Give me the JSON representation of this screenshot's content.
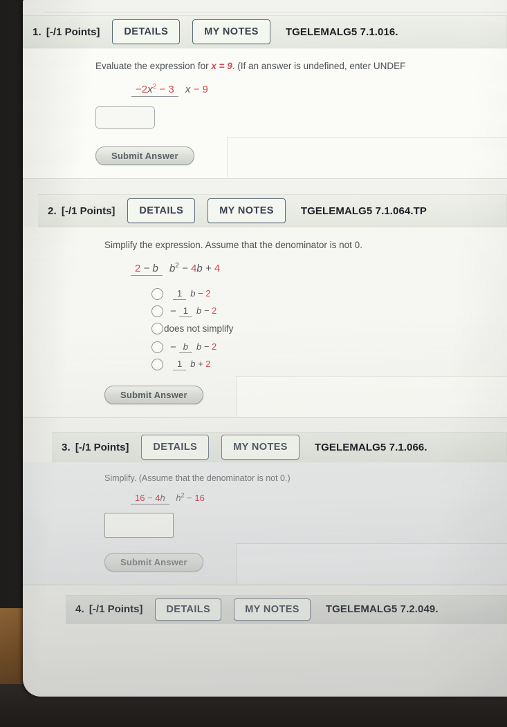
{
  "meta": {
    "app": "WebAssign homework page (photographed screen)",
    "accent_red": "#d94a52",
    "header_bg": "#e8ebe3"
  },
  "problems": [
    {
      "number": "1.",
      "points": "[-/1 Points]",
      "details_label": "DETAILS",
      "notes_label": "MY NOTES",
      "code": "TGELEMALG5 7.1.016.",
      "prompt_pre": "Evaluate the expression for",
      "prompt_var": "x = 9",
      "prompt_post": ". (If an answer is undefined, enter UNDEF",
      "expression": {
        "numerator": "−2x² − 3",
        "denominator": "x − 9",
        "num_main": "−2",
        "num_var": "x",
        "num_exp": "2",
        "num_tail": "− 3",
        "den_var": "x",
        "den_tail": "− 9"
      },
      "answer_value": "",
      "submit_label": "Submit Answer"
    },
    {
      "number": "2.",
      "points": "[-/1 Points]",
      "details_label": "DETAILS",
      "notes_label": "MY NOTES",
      "code": "TGELEMALG5 7.1.064.TP",
      "prompt": "Simplify the expression. Assume that the denominator is not 0.",
      "expression": {
        "num_lead": "2",
        "num_tail": " − b",
        "den_var": "b",
        "den_exp": "2",
        "den_tail1": " − ",
        "den_mid": "4",
        "den_tail2": "b + ",
        "den_end": "4"
      },
      "options": [
        {
          "sign": "",
          "num": "1",
          "den_var": "b − ",
          "den_num": "2",
          "plain": ""
        },
        {
          "sign": "−",
          "num": "1",
          "den_var": "b − ",
          "den_num": "2",
          "plain": ""
        },
        {
          "sign": "",
          "num": "",
          "den_var": "",
          "den_num": "",
          "plain": "does not simplify"
        },
        {
          "sign": "−",
          "num": "b",
          "den_var": "b − ",
          "den_num": "2",
          "plain": ""
        },
        {
          "sign": "",
          "num": "1",
          "den_var": "b + ",
          "den_num": "2",
          "plain": ""
        }
      ],
      "submit_label": "Submit Answer"
    },
    {
      "number": "3.",
      "points": "[-/1 Points]",
      "details_label": "DETAILS",
      "notes_label": "MY NOTES",
      "code": "TGELEMALG5 7.1.066.",
      "prompt": "Simplify. (Assume that the denominator is not 0.)",
      "expression": {
        "num_lead": "16",
        "num_mid": " − ",
        "num_coef": "4",
        "num_var": "h",
        "den_var": "h",
        "den_exp": "2",
        "den_mid": " − ",
        "den_num": "16"
      },
      "answer_value": "",
      "submit_label": "Submit Answer"
    },
    {
      "number": "4.",
      "points": "[-/1 Points]",
      "details_label": "DETAILS",
      "notes_label": "MY NOTES",
      "code": "TGELEMALG5 7.2.049."
    }
  ]
}
